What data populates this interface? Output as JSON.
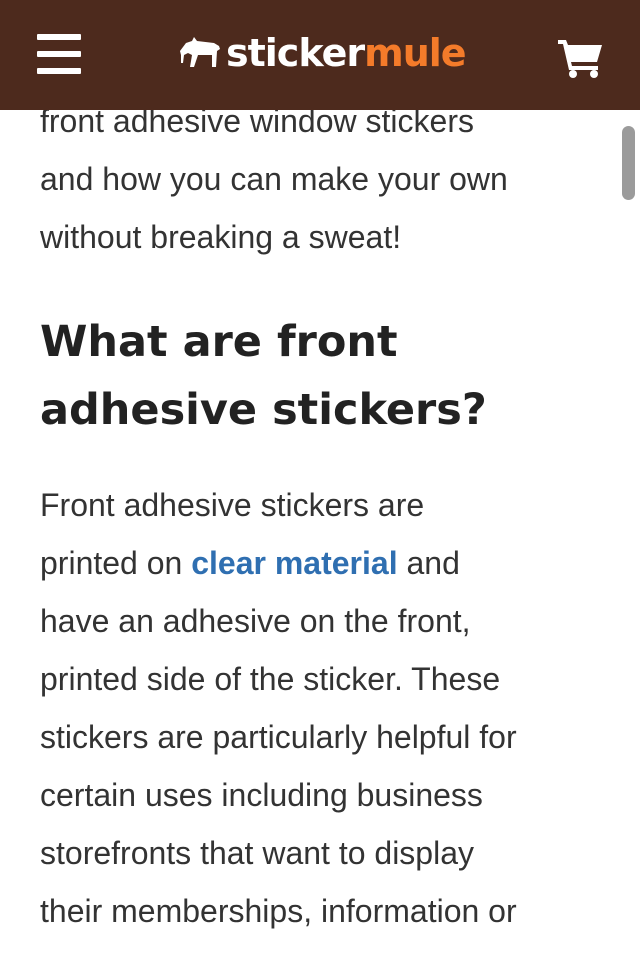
{
  "header": {
    "menu_icon": "hamburger-menu-icon",
    "logo_icon": "mule-icon",
    "logo_part1": "sticker",
    "logo_part2": "mule",
    "cart_icon": "shopping-cart-icon"
  },
  "article": {
    "intro_lines": [
      "front adhesive window stickers",
      "and how you can make your own",
      "without breaking a sweat!"
    ],
    "heading_lines": [
      "What are front",
      "adhesive stickers?"
    ],
    "body_line1": "Front adhesive stickers are",
    "body_line2_pre": "printed on ",
    "body_link": "clear material",
    "body_line2_post": " and",
    "body_lines_rest": [
      "have an adhesive on the front,",
      "printed side of the sticker. These",
      "stickers are particularly helpful for",
      "certain uses including business",
      "storefronts that want to display",
      "their memberships, information or"
    ]
  },
  "colors": {
    "header_bg": "#4d2a1d",
    "brand_orange": "#f47b2a",
    "link_blue": "#2f6fb1",
    "text": "#333333"
  }
}
